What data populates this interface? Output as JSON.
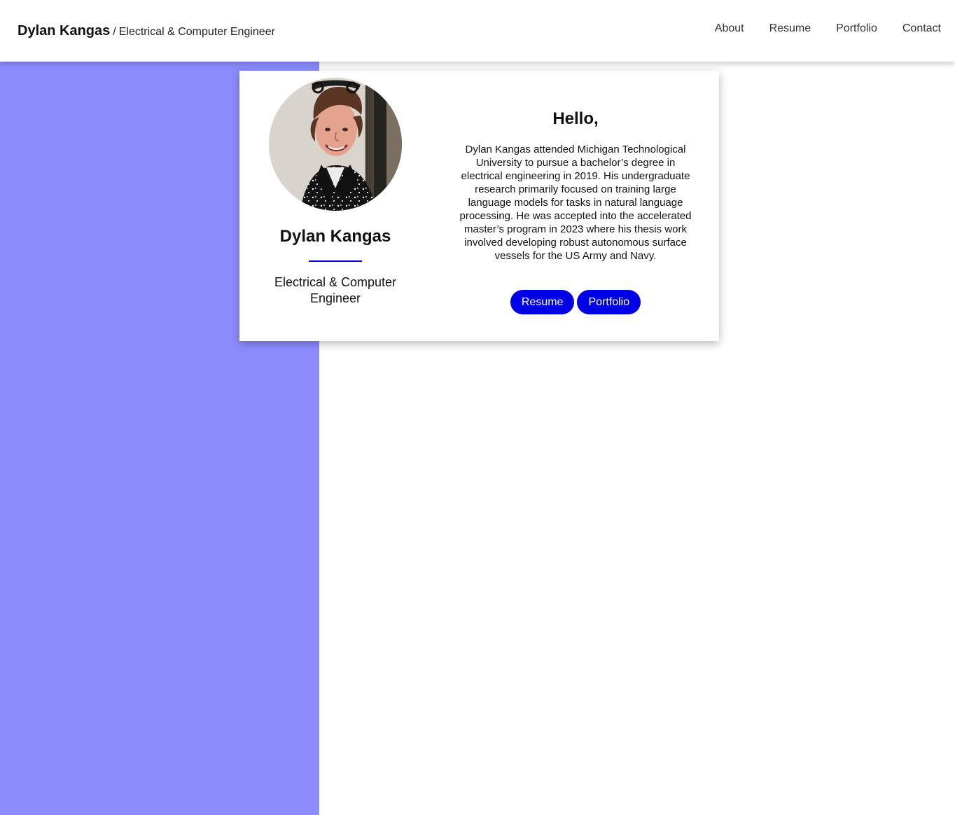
{
  "header": {
    "brand_name": "Dylan Kangas",
    "brand_separator": "/",
    "brand_role": "Electrical & Computer Engineer",
    "nav": [
      {
        "label": "About"
      },
      {
        "label": "Resume"
      },
      {
        "label": "Portfolio"
      },
      {
        "label": "Contact"
      }
    ]
  },
  "profile": {
    "name": "Dylan Kangas",
    "title": "Electrical & Computer Engineer"
  },
  "intro": {
    "greeting": "Hello,",
    "bio": "Dylan Kangas attended Michigan Technological University to pursue a bachelor’s degree in electrical engineering in 2019. His undergraduate research primarily focused on training large language models for tasks in natural language processing. He was accepted into the accelerated master’s program in 2023 where his thesis work involved developing robust autonomous surface vessels for the US Army and Navy.",
    "buttons": [
      {
        "label": "Resume"
      },
      {
        "label": "Portfolio"
      }
    ]
  },
  "theme": {
    "accent": "#0000e6",
    "side_band": "#8c8cff",
    "background": "#ffffff"
  }
}
